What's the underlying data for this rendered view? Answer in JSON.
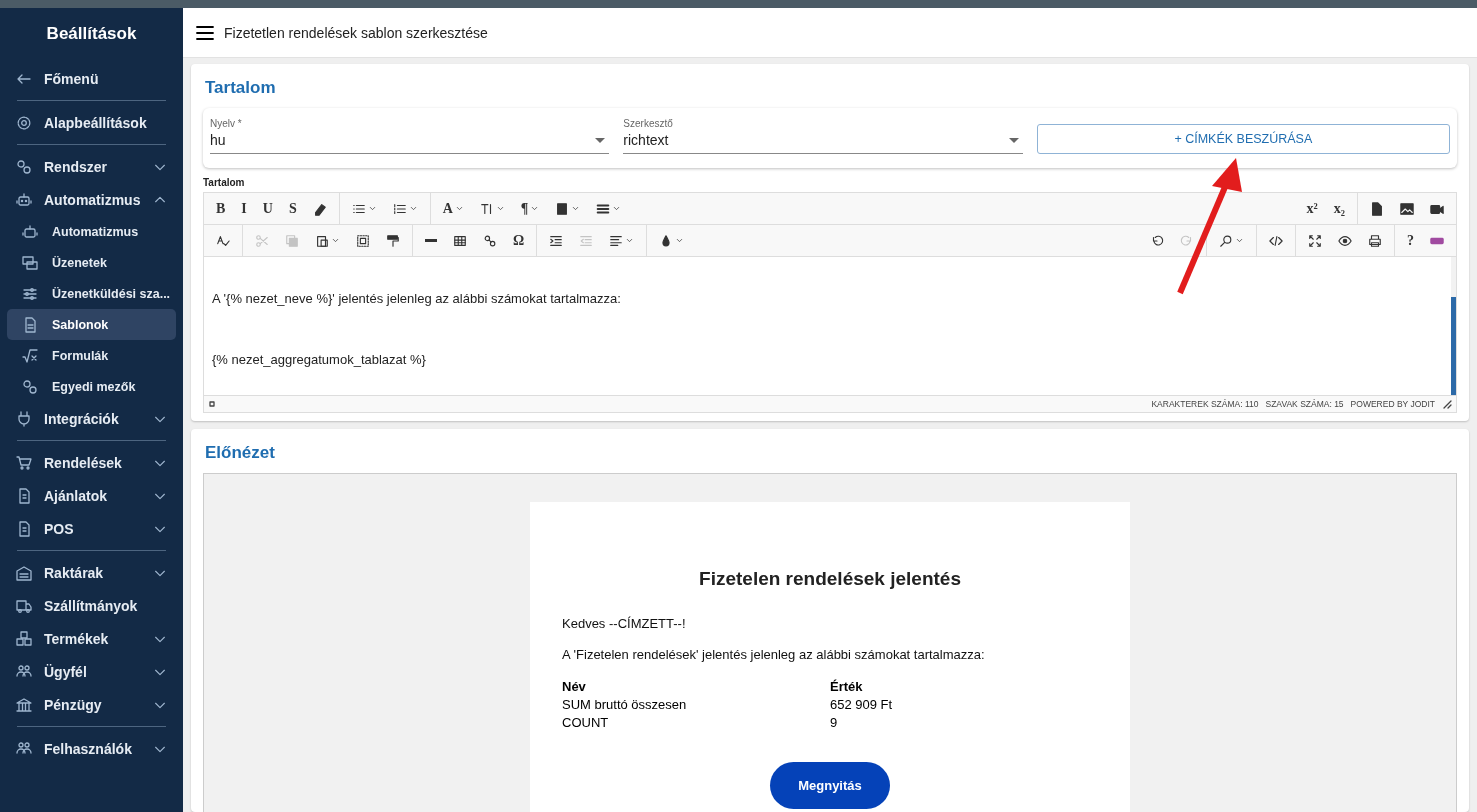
{
  "sidebar": {
    "title": "Beállítások",
    "items": [
      {
        "kind": "back",
        "label": "Főmenü"
      },
      {
        "kind": "divider"
      },
      {
        "kind": "item",
        "label": "Alapbeállítások"
      },
      {
        "kind": "divider"
      },
      {
        "kind": "item",
        "label": "Rendszer",
        "expanded": false
      },
      {
        "kind": "item",
        "label": "Automatizmus",
        "expanded": true,
        "children": [
          {
            "label": "Automatizmus",
            "selected": false
          },
          {
            "label": "Üzenetek",
            "selected": false
          },
          {
            "label": "Üzenetküldési sza...",
            "selected": false
          },
          {
            "label": "Sablonok",
            "selected": true
          },
          {
            "label": "Formulák",
            "selected": false
          },
          {
            "label": "Egyedi mezők",
            "selected": false
          }
        ]
      },
      {
        "kind": "item",
        "label": "Integrációk",
        "expanded": false
      },
      {
        "kind": "divider"
      },
      {
        "kind": "item",
        "label": "Rendelések",
        "expanded": false
      },
      {
        "kind": "item",
        "label": "Ajánlatok",
        "expanded": false
      },
      {
        "kind": "item",
        "label": "POS",
        "expanded": false
      },
      {
        "kind": "divider"
      },
      {
        "kind": "item",
        "label": "Raktárak",
        "expanded": false
      },
      {
        "kind": "item",
        "label": "Szállítmányok"
      },
      {
        "kind": "item",
        "label": "Termékek",
        "expanded": false
      },
      {
        "kind": "item",
        "label": "Ügyfél",
        "expanded": false
      },
      {
        "kind": "item",
        "label": "Pénzügy",
        "expanded": false
      },
      {
        "kind": "divider"
      },
      {
        "kind": "item",
        "label": "Felhasználók",
        "expanded": false
      }
    ]
  },
  "header": {
    "title": "Fizetetlen rendelések sablon szerkesztése"
  },
  "content": {
    "title": "Tartalom",
    "fields": [
      {
        "label": "Nyelv *",
        "value": "hu"
      },
      {
        "label": "Szerkesztő",
        "value": "richtext"
      }
    ],
    "insert_button": "+ CÍMKÉK BESZÚRÁSA",
    "editor": {
      "label": "Tartalom",
      "toolbar": [
        {
          "left": [
            [
              {
                "kind": "glyph",
                "glyph": "B"
              },
              {
                "kind": "glyph",
                "glyph": "I"
              },
              {
                "kind": "glyph",
                "glyph": "U"
              },
              {
                "kind": "glyph",
                "glyph": "S"
              },
              {
                "kind": "icon"
              }
            ],
            [
              {
                "kind": "icon",
                "dropdown": true
              },
              {
                "kind": "icon",
                "dropdown": true
              }
            ],
            [
              {
                "kind": "glyph",
                "glyph": "A",
                "dropdown": true
              },
              {
                "kind": "icon",
                "dropdown": true
              },
              {
                "kind": "glyph",
                "glyph": "¶",
                "dropdown": true
              },
              {
                "kind": "icon",
                "dropdown": true
              },
              {
                "kind": "icon",
                "dropdown": true
              }
            ]
          ],
          "right": [
            [
              {
                "kind": "glyph",
                "glyph": "x²"
              },
              {
                "kind": "glyph",
                "glyph": "x₂"
              }
            ],
            [
              {
                "kind": "icon"
              },
              {
                "kind": "icon"
              },
              {
                "kind": "icon"
              }
            ]
          ]
        },
        {
          "left": [
            [
              {
                "kind": "icon"
              }
            ],
            [
              {
                "kind": "icon",
                "disabled": true
              },
              {
                "kind": "icon",
                "disabled": true
              },
              {
                "kind": "icon",
                "dropdown": true
              },
              {
                "kind": "icon"
              },
              {
                "kind": "icon"
              }
            ],
            [
              {
                "kind": "icon"
              },
              {
                "kind": "icon"
              },
              {
                "kind": "icon"
              },
              {
                "kind": "glyph",
                "glyph": "Ω"
              }
            ],
            [
              {
                "kind": "icon"
              },
              {
                "kind": "icon",
                "disabled": true
              },
              {
                "kind": "icon",
                "dropdown": true
              }
            ],
            [
              {
                "kind": "icon",
                "dropdown": true
              }
            ]
          ],
          "right": [
            [
              {
                "kind": "icon"
              },
              {
                "kind": "icon",
                "disabled": true
              }
            ],
            [
              {
                "kind": "icon",
                "dropdown": true
              }
            ],
            [
              {
                "kind": "icon"
              }
            ],
            [
              {
                "kind": "icon"
              },
              {
                "kind": "icon"
              },
              {
                "kind": "icon"
              }
            ],
            [
              {
                "kind": "glyph",
                "glyph": "?"
              },
              {
                "kind": "icon"
              }
            ]
          ]
        }
      ],
      "paragraphs": [
        "A '{% nezet_neve %}' jelentés jelenleg az alábbi számokat tartalmazza:",
        "{% nezet_aggregatumok_tablazat %}"
      ],
      "status": [
        "KARAKTEREK SZÁMA: 110",
        "SZAVAK SZÁMA: 15",
        "POWERED BY JODIT"
      ]
    }
  },
  "preview": {
    "title": "Előnézet",
    "email": {
      "heading": "Fizetelen rendelések jelentés",
      "greeting": "Kedves --CÍMZETT--!",
      "intro": "A 'Fizetelen rendelések' jelentés jelenleg az alábbi számokat tartalmazza:",
      "columns": [
        "Név",
        "Érték"
      ],
      "rows": [
        [
          "SUM bruttó összesen",
          "652 909 Ft"
        ],
        [
          "COUNT",
          "9"
        ]
      ],
      "button": "Megnyitás"
    }
  }
}
